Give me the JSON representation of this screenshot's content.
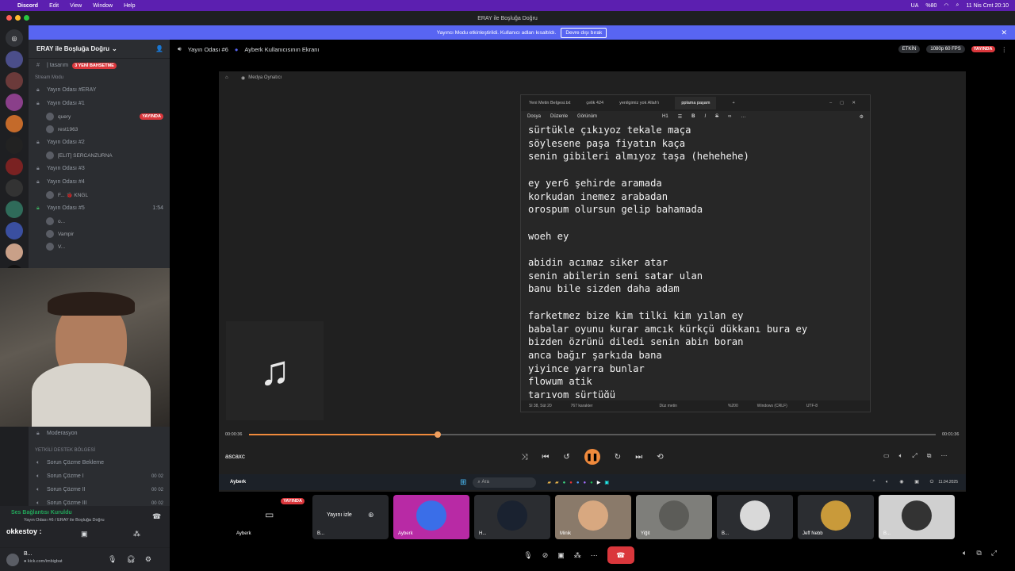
{
  "menubar": {
    "app": "Discord",
    "items": [
      "Edit",
      "View",
      "Window",
      "Help"
    ],
    "lang": "UA",
    "battery": "%80",
    "clock": "11 Nis Cmt 20:10"
  },
  "window": {
    "title": "ERAY ile Boşluğa Doğru"
  },
  "banner": {
    "text": "Yayıncı Modu etkinleştirildi. Kullanıcı adları kısaltıldı.",
    "button": "Devre dışı bırak"
  },
  "sidebar": {
    "server_name": "ERAY ile Boşluğa Doğru",
    "top_channel": "| tasarım",
    "new_mentions": "3 YENİ BAHSETME",
    "stream_mode": "Stream Modu",
    "channels": [
      {
        "name": "Yayın Odası #ERAY"
      },
      {
        "name": "Yayın Odası #1",
        "users": [
          {
            "name": "query",
            "live": "YAYINDA"
          },
          {
            "name": "rest1963"
          }
        ]
      },
      {
        "name": "Yayın Odası #2",
        "users": [
          {
            "name": "[ELIT] SERCANZURNA"
          }
        ]
      },
      {
        "name": "Yayın Odası #3"
      },
      {
        "name": "Yayın Odası #4",
        "users": [
          {
            "name": "F... 🐞 KNGL"
          }
        ]
      },
      {
        "name": "Yayın Odası #5",
        "time": "1:54",
        "users": [
          {
            "name": "o..."
          },
          {
            "name": "Vampir"
          },
          {
            "name": "V..."
          }
        ]
      }
    ],
    "moderation": "Moderasyon",
    "support_category": "YETKİLİ DESTEK BÖLGESİ",
    "support_channels": [
      {
        "name": "Sorun Çözme Bekleme"
      },
      {
        "name": "Sorun Çözme I",
        "a": "00",
        "b": "02"
      },
      {
        "name": "Sorun Çözme II",
        "a": "00",
        "b": "02"
      },
      {
        "name": "Sorun Çözme III",
        "a": "00",
        "b": "02"
      }
    ],
    "voice_status": "Ses Bağlantısı Kuruldu",
    "voice_channel": "Yayın Odası #6 / ERAY ile Boşluğa Doğru",
    "overlay_name": "okkestoy :",
    "user_name": "B...",
    "user_status": "● kick.com/imbigbat"
  },
  "topbar": {
    "channel": "Yayın Odası #6",
    "screen_title": "Ayberk Kullanıcısının Ekranı",
    "active": "ETKİN",
    "quality": "1080p 60 FPS",
    "live": "YAYINDA"
  },
  "mediaplayer": {
    "title": "Medya Oynatıcı",
    "track": "ascaxc",
    "elapsed": "00:00:36",
    "total": "00:01:36",
    "progress": 0.275
  },
  "notepad": {
    "tabs": [
      "Yeni Metin Belgesi.txt",
      "çelik 424",
      "yenilgimiz yok Allah'ı",
      "pplama paşam"
    ],
    "menu": [
      "Dosya",
      "Düzenle",
      "Görünüm"
    ],
    "heading": "H1",
    "text": "sürtükle çıkıyoz tekale maça\nsöylesene paşa fiyatın kaça\nsenin gibileri almıyoz taşa (hehehehe)\n\ney yer6 şehirde aramada\nkorkudan inemez arabadan\norospum olursun gelip bahamada\n\nwoeh ey\n\nabidin acımaz siker atar\nsenin abilerin seni satar ulan\nbanu bile sizden daha adam\n\nfarketmez bize kim tilki kim yılan ey\nbabalar oyunu kurar amcık kürkçü dükkanı bura ey\nbizden özrünü diledi senin abin boran\nanca bağır şarkıda bana\nyiyince yarra bunlar\nflowum atik\ntarıyom sürtüğü",
    "status": [
      "Sl 38, Süt 20",
      "767 karakter",
      "Düz metin",
      "%200",
      "Windows (CRLF)",
      "UTF-8"
    ]
  },
  "taskbar": {
    "user": "Ayberk",
    "search": "Ara",
    "date": "11.04.2025"
  },
  "tiles": [
    {
      "name": "Ayberk",
      "badge": "YAYINDA"
    },
    {
      "name": "B...",
      "action": "Yayını izle"
    },
    {
      "name": "Ayberk"
    },
    {
      "name": "H..."
    },
    {
      "name": "Minik"
    },
    {
      "name": "Yiğit"
    },
    {
      "name": "B..."
    },
    {
      "name": "Jeff Nebb"
    },
    {
      "name": "B..."
    }
  ],
  "colors": {
    "accent": "#5865f2",
    "live": "#da373c",
    "progress": "#f08a3c",
    "menubar": "#5c1fb0"
  }
}
